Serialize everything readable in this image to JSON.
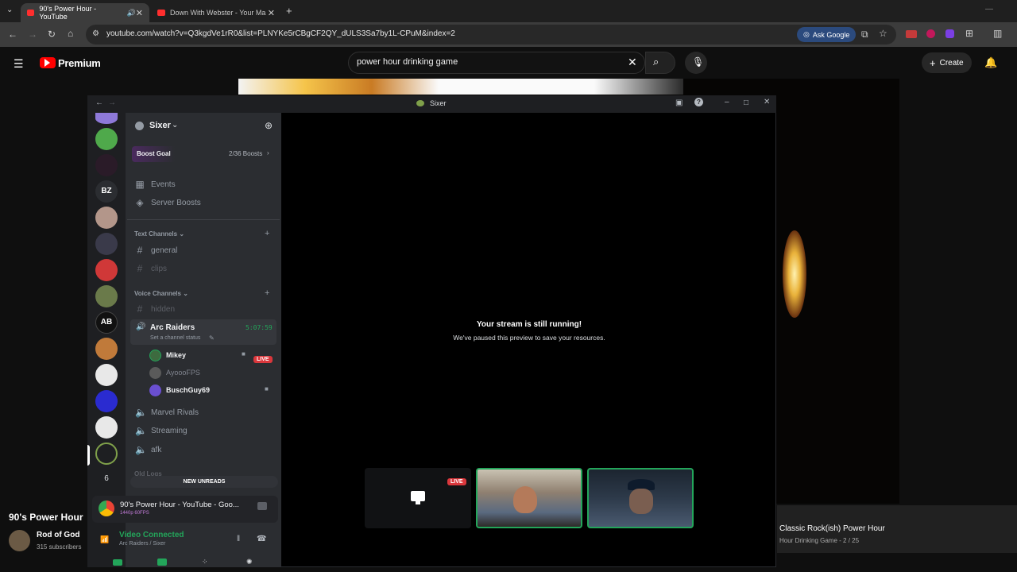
{
  "browser": {
    "tabs": [
      {
        "label": "90's Power Hour - YouTube"
      },
      {
        "label": "Down With Webster - Your Ma"
      }
    ],
    "url": "youtube.com/watch?v=Q3kgdVe1rR0&list=PLNYKe5rCBgCF2QY_dULS3Sa7by1L-CPuM&index=2",
    "ask_google": "Ask Google"
  },
  "youtube": {
    "brand": "Premium",
    "search_value": "power hour drinking game",
    "create_label": "Create",
    "video_title_partial": "90's Power Hour",
    "channel_name": "Rod of God",
    "subscribers": "315 subscribers",
    "playlist_title": "Classic Rock(ish) Power Hour",
    "playlist_sub": "Hour Drinking Game - 2 / 25"
  },
  "discord": {
    "window_title": "Sixer",
    "server_name": "Sixer",
    "boost_goal": "Boost Goal",
    "boost_count": "2/36 Boosts",
    "menu": [
      {
        "label": "Events"
      },
      {
        "label": "Server Boosts"
      }
    ],
    "text_channels_header": "Text Channels",
    "text_channels": [
      {
        "label": "general"
      },
      {
        "label": "clips"
      }
    ],
    "voice_channels_header": "Voice Channels",
    "hidden_channel": "hidden",
    "active_voice": {
      "label": "Arc Raiders",
      "timer": "5:07:59",
      "status": "Set a channel status"
    },
    "members": [
      {
        "name": "Mikey",
        "live": "LIVE"
      },
      {
        "name": "AyoooFPS"
      },
      {
        "name": "BuschGuy69"
      }
    ],
    "voice_channels": [
      {
        "label": "Marvel Rivals"
      },
      {
        "label": "Streaming"
      },
      {
        "label": "afk"
      }
    ],
    "old_logs": "Old Logs",
    "new_unreads": "NEW UNREADS",
    "guild_letters": "BZ",
    "guild_count": "6",
    "stream_activity": {
      "title": "90's Power Hour - YouTube - Goo...",
      "quality": "1440p 60FPS"
    },
    "voice_status": {
      "label": "Video Connected",
      "sub": "Arc Raiders / Sixer"
    },
    "stage": {
      "headline": "Your stream is still running!",
      "sub": "We've paused this preview to save your resources.",
      "live_badge": "LIVE"
    }
  }
}
